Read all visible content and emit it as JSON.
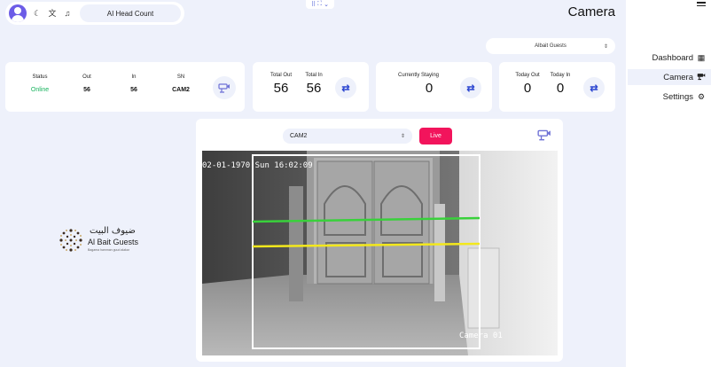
{
  "header": {
    "head_count_label": "AI Head Count",
    "page_title": "Camera",
    "theme_icon": "moon-icon",
    "translate_icon": "translate-icon",
    "bell_icon": "bell-icon"
  },
  "org_select": {
    "value": "Albait Guests"
  },
  "status_card": {
    "status_label": "Status",
    "status_value": "Online",
    "out_label": "Out",
    "out_value": "56",
    "in_label": "In",
    "in_value": "56",
    "sn_label": "SN",
    "sn_value": "CAM2"
  },
  "totals_card": {
    "out_label": "Total Out",
    "in_label": "Total In",
    "out_value": "56",
    "in_value": "56"
  },
  "staying_card": {
    "label": "Currently Staying",
    "value": "0"
  },
  "today_card": {
    "out_label": "Today Out",
    "in_label": "Today In",
    "out_value": "0",
    "in_value": "0"
  },
  "logo": {
    "arabic": "ضيوف البيت",
    "english": "Al Bait Guests",
    "tagline": "Bagama hamman guud alakar"
  },
  "camera_panel": {
    "selected_camera": "CAM2",
    "live_label": "Live",
    "osd_timestamp": "02-01-1970 Sun 16:02:09",
    "osd_camera": "Camera 01"
  },
  "sidebar": {
    "items": [
      {
        "label": "Dashboard",
        "icon": "grid-icon",
        "active": false
      },
      {
        "label": "Camera",
        "icon": "cctv-icon",
        "active": true
      },
      {
        "label": "Settings",
        "icon": "gear-icon",
        "active": false
      }
    ]
  },
  "colors": {
    "accent": "#2f49d1",
    "live": "#f2145c",
    "online": "#17b35e",
    "avatar": "#6c5ce7"
  }
}
